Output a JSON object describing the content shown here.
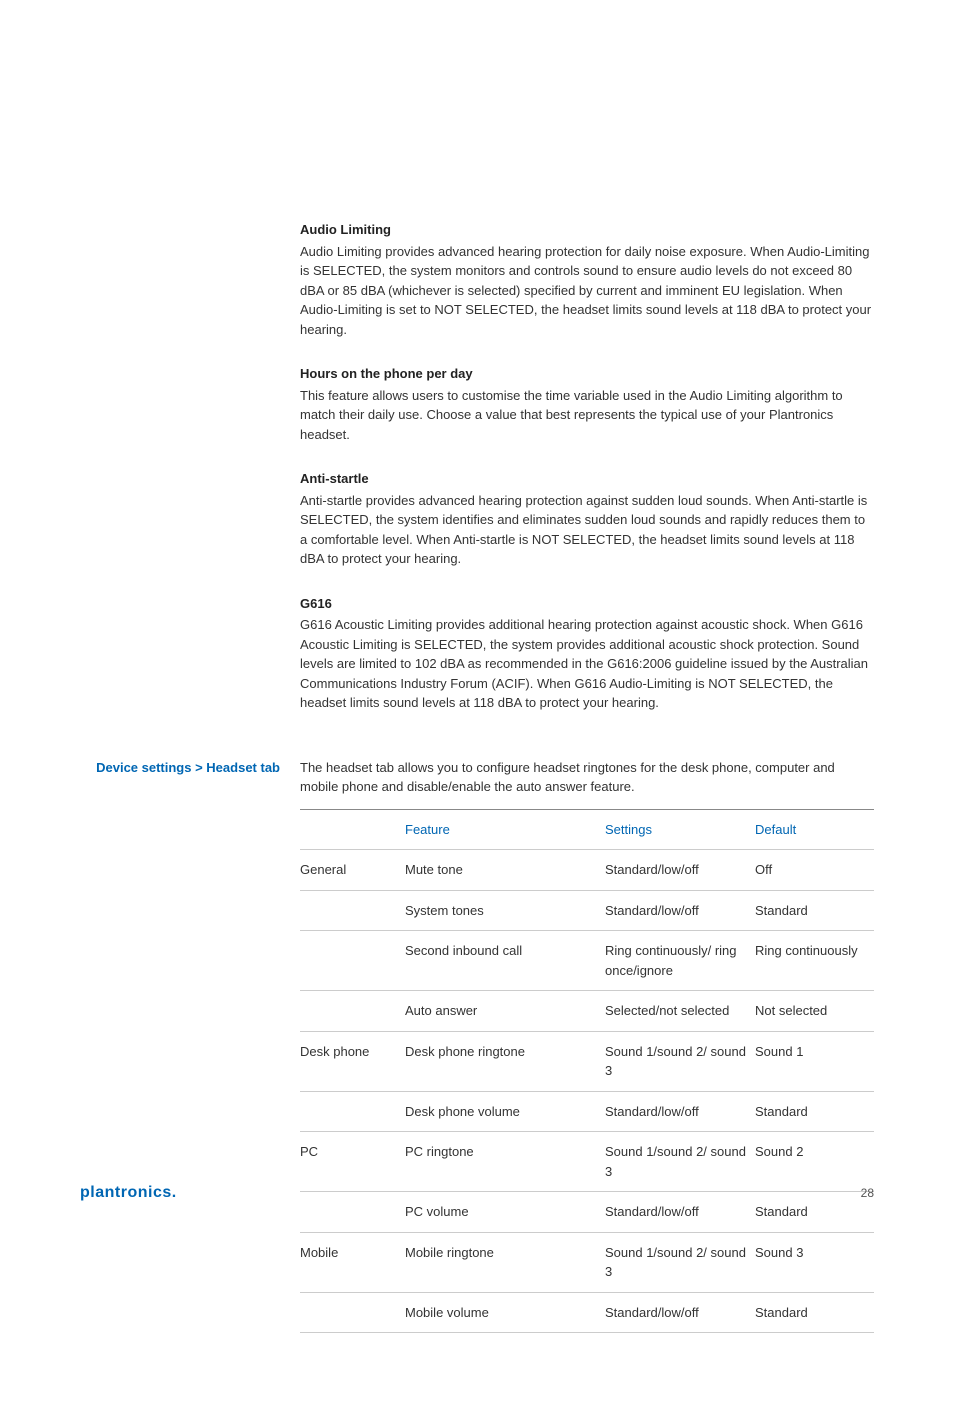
{
  "sections": [
    {
      "title": "Audio Limiting",
      "body": "Audio Limiting provides advanced hearing protection for daily noise exposure. When Audio-Limiting is SELECTED, the system monitors and controls sound to ensure audio levels do not exceed 80 dBA or 85 dBA (whichever is selected) specified by current and imminent EU legislation. When Audio-Limiting is set to NOT SELECTED, the headset limits sound levels at 118 dBA to protect your hearing."
    },
    {
      "title": "Hours on the phone per day",
      "body": "This feature allows users to customise the time variable used in the Audio Limiting algorithm to match their daily use. Choose a value that best represents the typical use of your Plantronics headset."
    },
    {
      "title": "Anti-startle",
      "body": "Anti-startle provides advanced hearing protection against sudden loud sounds. When Anti-startle is SELECTED, the system identifies and eliminates sudden loud sounds and rapidly reduces them to a comfortable level. When Anti-startle is NOT SELECTED, the headset limits sound levels at 118 dBA to protect your hearing."
    },
    {
      "title": "G616",
      "body": "G616 Acoustic Limiting provides additional hearing protection against acoustic shock. When G616 Acoustic Limiting is SELECTED, the system provides additional acoustic shock protection. Sound levels are limited to 102 dBA as recommended in the G616:2006 guideline issued by the Australian Communications Industry Forum (ACIF). When G616 Audio-Limiting is NOT SELECTED, the headset limits sound levels at 118 dBA to protect your hearing."
    }
  ],
  "sidebar_title": "Device settings > Headset tab",
  "intro": "The headset tab allows you to configure headset ringtones for the desk phone, computer and mobile phone and disable/enable the auto answer feature.",
  "table": {
    "headers": [
      "",
      "Feature",
      "Settings",
      "Default"
    ],
    "rows": [
      [
        "General",
        "Mute tone",
        "Standard/low/off",
        "Off"
      ],
      [
        "",
        "System tones",
        "Standard/low/off",
        "Standard"
      ],
      [
        "",
        "Second inbound call",
        "Ring continuously/ ring once/ignore",
        "Ring continuously"
      ],
      [
        "",
        "Auto answer",
        "Selected/not selected",
        "Not selected"
      ],
      [
        "Desk phone",
        "Desk phone ringtone",
        "Sound 1/sound 2/ sound 3",
        "Sound 1"
      ],
      [
        "",
        "Desk phone volume",
        "Standard/low/off",
        "Standard"
      ],
      [
        "PC",
        "PC ringtone",
        "Sound 1/sound 2/ sound 3",
        "Sound 2"
      ],
      [
        "",
        "PC volume",
        "Standard/low/off",
        "Standard"
      ],
      [
        "Mobile",
        "Mobile ringtone",
        "Sound 1/sound 2/ sound 3",
        "Sound 3"
      ],
      [
        "",
        "Mobile volume",
        "Standard/low/off",
        "Standard"
      ]
    ]
  },
  "footer": {
    "brand": "plantronics.",
    "page": "28"
  }
}
